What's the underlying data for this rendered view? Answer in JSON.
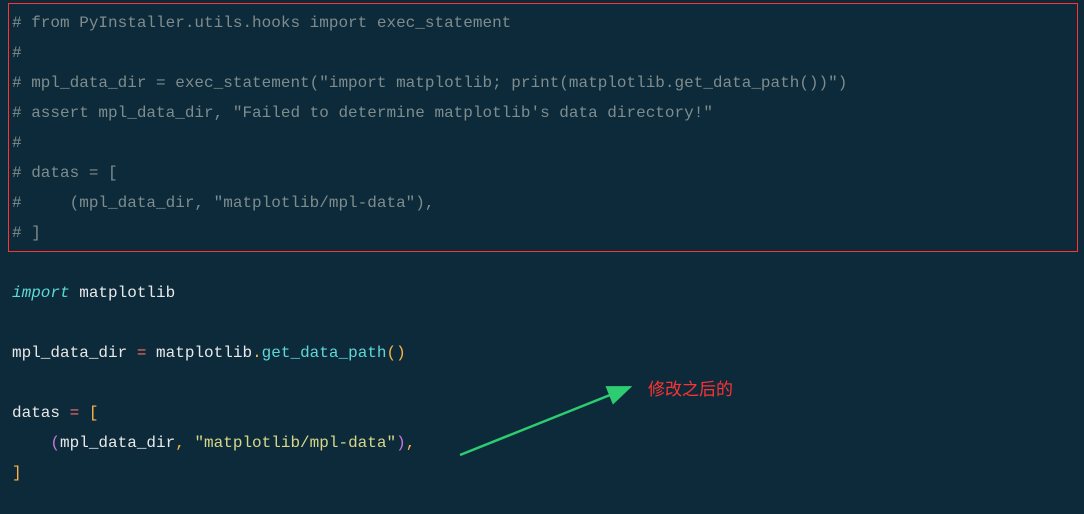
{
  "code": {
    "comment_line_1": "# from PyInstaller.utils.hooks import exec_statement",
    "comment_line_2": "#",
    "comment_line_3": "# mpl_data_dir = exec_statement(\"import matplotlib; print(matplotlib.get_data_path())\")",
    "comment_line_4": "# assert mpl_data_dir, \"Failed to determine matplotlib's data directory!\"",
    "comment_line_5": "#",
    "comment_line_6": "# datas = [",
    "comment_line_7": "#     (mpl_data_dir, \"matplotlib/mpl-data\"),",
    "comment_line_8": "# ]",
    "import_keyword": "import",
    "import_module": " matplotlib",
    "var_mpl_data_dir": "mpl_data_dir ",
    "op_equals": "=",
    "call_module": " matplotlib",
    "dot": ".",
    "call_func": "get_data_path",
    "paren_open": "(",
    "paren_close": ")",
    "var_datas": "datas ",
    "op_equals2": "=",
    "bracket_open": " [",
    "tuple_indent": "    ",
    "tuple_paren_open": "(",
    "tuple_var": "mpl_data_dir",
    "tuple_comma": ", ",
    "tuple_string": "\"matplotlib/mpl-data\"",
    "tuple_paren_close": ")",
    "tuple_trailing_comma": ",",
    "bracket_close": "]"
  },
  "annotation": {
    "text": "修改之后的"
  }
}
